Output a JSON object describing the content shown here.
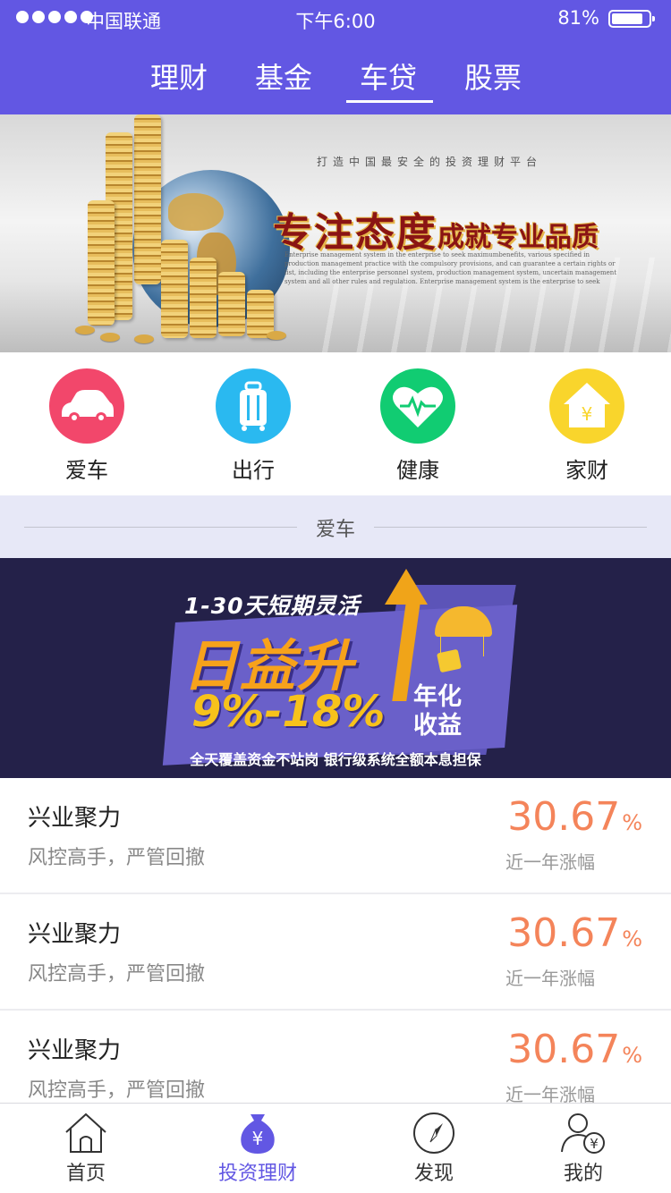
{
  "status_bar": {
    "carrier": "中国联通",
    "time": "下午6:00",
    "battery": "81%",
    "battery_level": 0.81
  },
  "tabs": [
    {
      "label": "理财"
    },
    {
      "label": "基金"
    },
    {
      "label": "车贷",
      "active": true
    },
    {
      "label": "股票"
    }
  ],
  "hero_banner": {
    "tagline": "打造中国最安全的投资理财平台",
    "title_big": "专注态度",
    "title_small": "成就专业品质",
    "body": "Enterprise management system in the enterprise to seek maximumbenefits, various specified in production management practice with the compulsory provisions, and can guarantee a certain rights or list, including the enterprise personnel system, production management system, uncertain management system and all other rules and regulation. Enterprise management system is the enterprise to seek"
  },
  "categories": [
    {
      "label": "爱车",
      "icon": "car-icon",
      "color": "#f2476b"
    },
    {
      "label": "出行",
      "icon": "luggage-icon",
      "color": "#2ab9f0"
    },
    {
      "label": "健康",
      "icon": "heart-icon",
      "color": "#11cc72"
    },
    {
      "label": "家财",
      "icon": "house-yuan-icon",
      "color": "#f9d52c"
    }
  ],
  "section": {
    "title": "爱车"
  },
  "promo_banner": {
    "line1": "1-30天短期灵活",
    "line2": "日益升",
    "line3": "9%-18%",
    "line4": "年化收益",
    "footer": "全天覆盖资金不站岗 银行级系统全额本息担保"
  },
  "products": [
    {
      "name": "兴业聚力",
      "desc": "风控高手，严管回撤",
      "rate": "30.67",
      "unit": "%",
      "rate_label": "近一年涨幅"
    },
    {
      "name": "兴业聚力",
      "desc": "风控高手，严管回撤",
      "rate": "30.67",
      "unit": "%",
      "rate_label": "近一年涨幅"
    },
    {
      "name": "兴业聚力",
      "desc": "风控高手，严管回撤",
      "rate": "30.67",
      "unit": "%",
      "rate_label": "近一年涨幅"
    }
  ],
  "bottom_nav": [
    {
      "label": "首页",
      "icon": "home-icon"
    },
    {
      "label": "投资理财",
      "icon": "money-bag-icon",
      "active": true
    },
    {
      "label": "发现",
      "icon": "compass-icon"
    },
    {
      "label": "我的",
      "icon": "user-yuan-icon"
    }
  ],
  "colors": {
    "brand": "#6257e3",
    "rate": "#f4845a",
    "section_bg": "#e7e8f7",
    "promo_bg": "#242149"
  }
}
